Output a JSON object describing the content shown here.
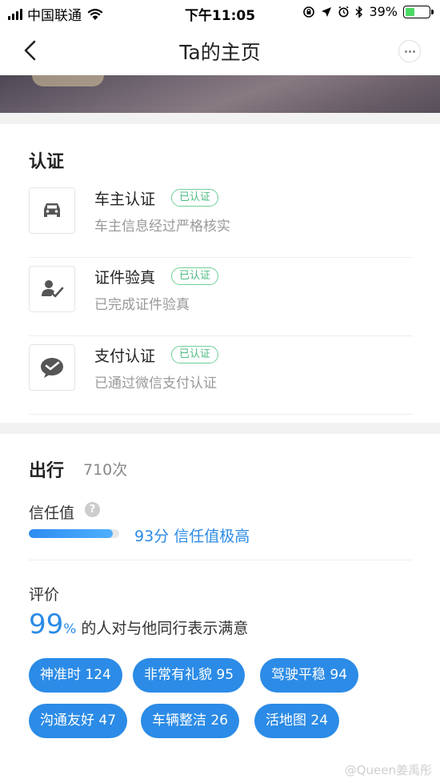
{
  "status_bar": {
    "carrier": "中国联通",
    "time": "下午11:05",
    "battery": "39%",
    "battery_level": 0.39
  },
  "nav": {
    "title": "Ta的主页"
  },
  "certification": {
    "title": "认证",
    "items": [
      {
        "title": "车主认证",
        "badge": "已认证",
        "subtitle": "车主信息经过严格核实",
        "icon": "car-icon"
      },
      {
        "title": "证件验真",
        "badge": "已认证",
        "subtitle": "已完成证件验真",
        "icon": "id-verify-icon"
      },
      {
        "title": "支付认证",
        "badge": "已认证",
        "subtitle": "已通过微信支付认证",
        "icon": "wechat-pay-icon"
      }
    ]
  },
  "trip": {
    "title": "出行",
    "count": "710次",
    "trust_label": "信任值",
    "help_glyph": "?",
    "trust_text": "93分 信任值极高",
    "trust_score": 93
  },
  "evaluation": {
    "label": "评价",
    "percent": "99",
    "percent_sign": "%",
    "text": "的人对与他同行表示满意",
    "tags": [
      "神准时 124",
      "非常有礼貌 95",
      "驾驶平稳 94",
      "沟通友好 47",
      "车辆整洁 26",
      "活地图 24"
    ]
  },
  "watermark": "@Queen姜禹彤",
  "colors": {
    "accent": "#2b8be6",
    "badge_green": "#4cbb7f",
    "section_gap": "#f2f2f2"
  }
}
